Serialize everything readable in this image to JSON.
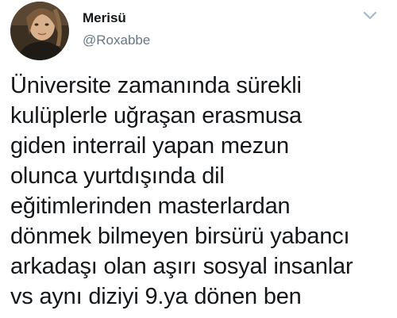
{
  "author": {
    "display_name": "Merisü",
    "handle": "@Roxabbe",
    "avatar_icon": "profile-photo"
  },
  "menu": {
    "icon": "chevron-down-icon"
  },
  "tweet": {
    "lines": [
      "Üniversite zamanında sürekli",
      "kulüplerle uğraşan erasmusa",
      "giden interrail yapan mezun",
      "olunca yurtdışında dil",
      "eğitimlerinden masterlardan",
      "dönmek bilmeyen birsürü yabancı",
      "arkadaşı olan aşırı sosyal insanlar",
      "vs aynı diziyi 9.ya dönen ben"
    ]
  },
  "colors": {
    "text": "#14171a",
    "secondary_text": "#657786",
    "caret": "#aab8c2",
    "background": "#ffffff"
  }
}
